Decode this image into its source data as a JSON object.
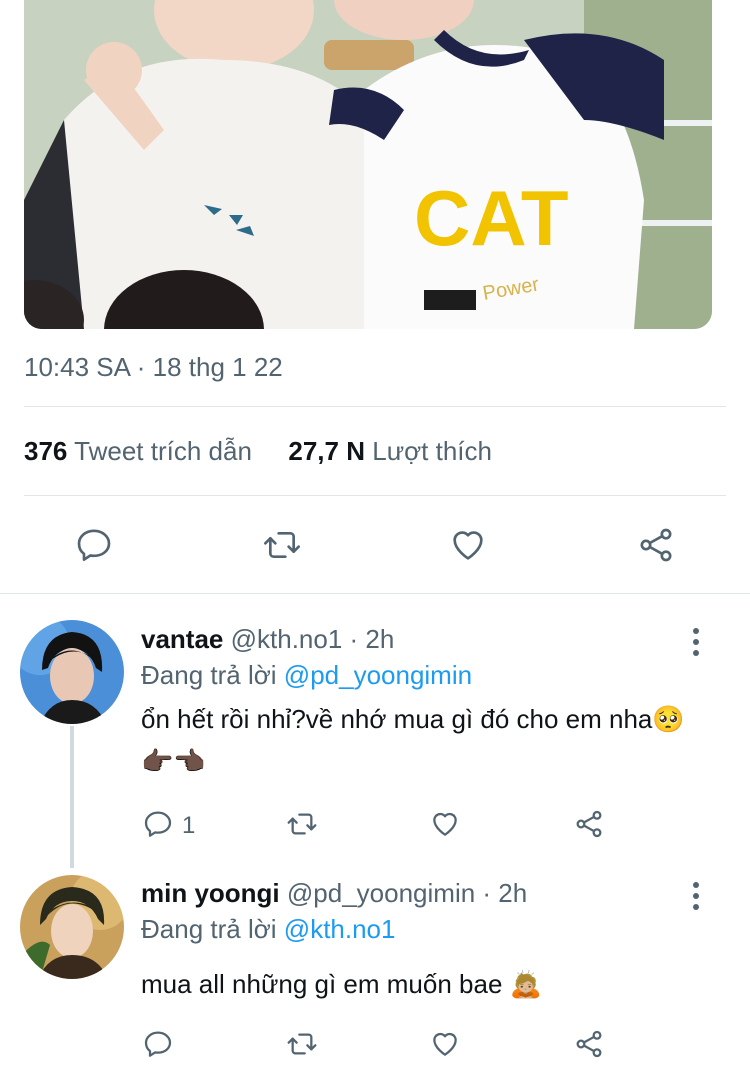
{
  "tweet": {
    "timestamp": "10:43 SA · 18 thg 1 22",
    "quote_count": "376",
    "quote_label": "Tweet trích dẫn",
    "like_count": "27,7 N",
    "like_label": "Lượt thích"
  },
  "replies": [
    {
      "display_name": "vantae",
      "meta": "@kth.no1 · 2h",
      "replying_prefix": "Đang trả lời",
      "replying_to": "@pd_yoongimin",
      "text": "ổn hết rồi nhỉ?về nhớ mua gì đó cho em nha🥺👉🏿👈🏿",
      "reply_count": "1"
    },
    {
      "display_name": "min yoongi",
      "meta": "@pd_yoongimin · 2h",
      "replying_prefix": "Đang trả lời",
      "replying_to": "@kth.no1",
      "text": "mua all những gì em muốn bae 🙇🏼",
      "reply_count": ""
    }
  ],
  "photo": {
    "shirt_text": "CAT",
    "shirt_subtext": "Power"
  },
  "icons": {
    "reply": "reply-icon",
    "retweet": "retweet-icon",
    "like": "heart-icon",
    "share": "share-icon",
    "more": "more-icon"
  },
  "colors": {
    "link": "#1d9bf0",
    "secondary_text": "#536471",
    "divider": "#e1e6ea"
  }
}
